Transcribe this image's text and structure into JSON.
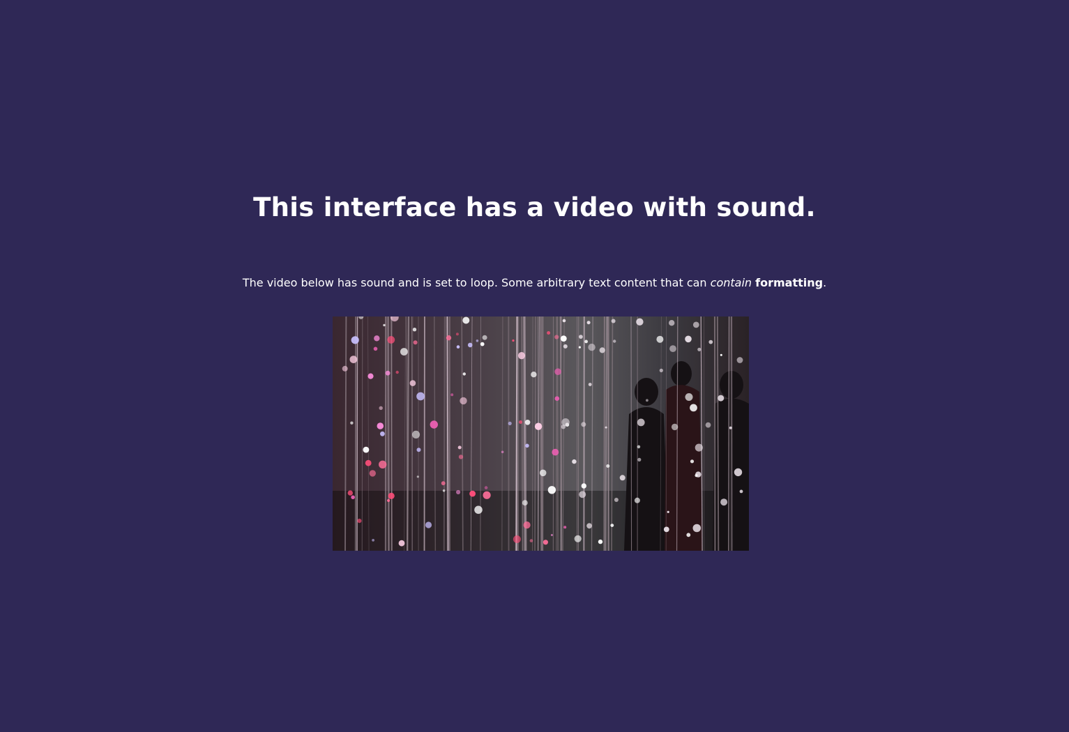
{
  "page": {
    "title": "This interface has a video with sound.",
    "description": {
      "part1": "The video below has sound and is set to loop. Some arbitrary text content that can ",
      "italic": "contain",
      "space": " ",
      "bold": "formatting",
      "end": "."
    }
  },
  "video": {
    "icon": "video-player",
    "has_sound": true,
    "loop": true
  },
  "colors": {
    "background": "#2f2856",
    "text": "#ffffff"
  }
}
